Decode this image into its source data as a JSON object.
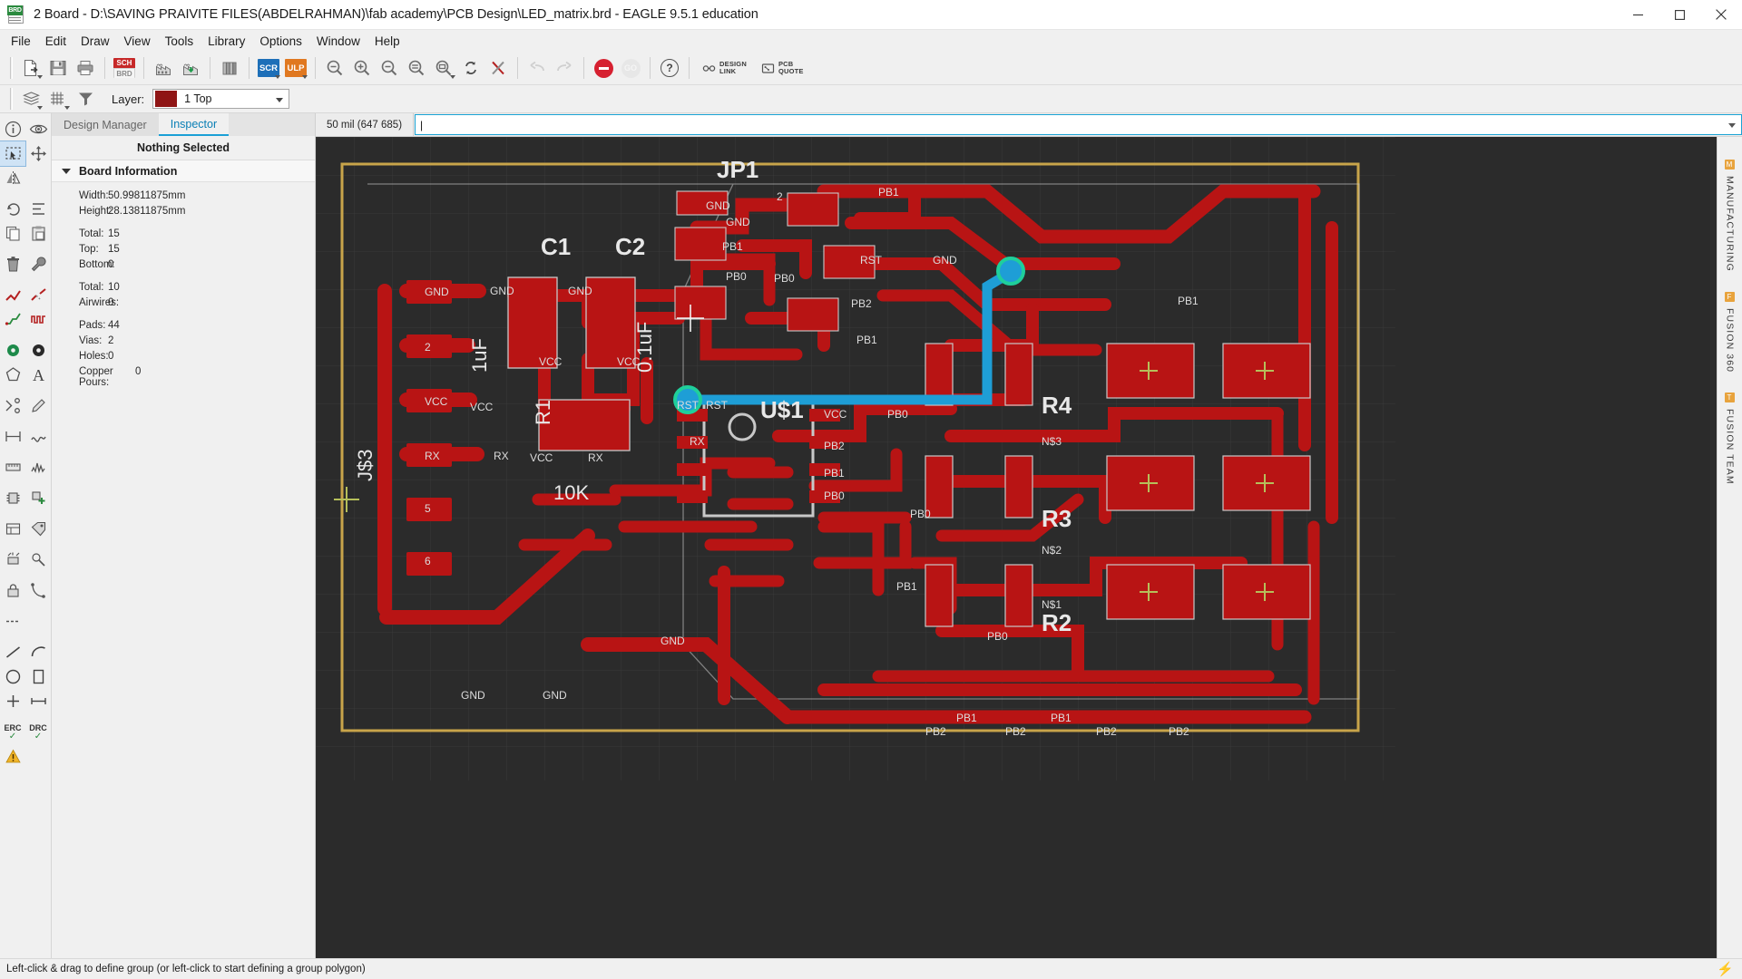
{
  "window": {
    "title": "2 Board - D:\\SAVING PRAIVITE FILES(ABDELRAHMAN)\\fab academy\\PCB Design\\LED_matrix.brd - EAGLE 9.5.1 education",
    "icon": "board-file-icon",
    "minimize_label": "Minimize",
    "maximize_label": "Maximize",
    "close_label": "Close"
  },
  "menu": {
    "items": [
      {
        "label": "File"
      },
      {
        "label": "Edit"
      },
      {
        "label": "Draw"
      },
      {
        "label": "View"
      },
      {
        "label": "Tools"
      },
      {
        "label": "Library"
      },
      {
        "label": "Options"
      },
      {
        "label": "Window"
      },
      {
        "label": "Help"
      }
    ]
  },
  "toolbar": {
    "buttons": [
      {
        "name": "open-file",
        "icon": "file-open-icon"
      },
      {
        "name": "save",
        "icon": "save-floppy-icon"
      },
      {
        "name": "print",
        "icon": "printer-icon"
      },
      {
        "name": "switch-to-schematic",
        "icon": "sch-brd-icon",
        "label_top": "SCH",
        "label_bottom": "BRD"
      },
      {
        "name": "cam-processor",
        "icon": "factory-icon"
      },
      {
        "name": "manufacturing-export",
        "icon": "factory-download-icon"
      },
      {
        "name": "library-manager",
        "icon": "books-icon"
      },
      {
        "name": "run-script",
        "icon": "scr-icon",
        "label": "SCR"
      },
      {
        "name": "run-ulp",
        "icon": "ulp-icon",
        "label": "ULP"
      },
      {
        "name": "zoom-fit",
        "icon": "zoom-fit-icon"
      },
      {
        "name": "zoom-in",
        "icon": "zoom-in-icon"
      },
      {
        "name": "zoom-out",
        "icon": "zoom-out-icon"
      },
      {
        "name": "zoom-redraw",
        "icon": "zoom-redraw-icon"
      },
      {
        "name": "zoom-select",
        "icon": "zoom-select-icon"
      },
      {
        "name": "refresh",
        "icon": "refresh-icon"
      },
      {
        "name": "ratsnest",
        "icon": "ratsnest-icon"
      },
      {
        "name": "undo",
        "icon": "undo-arrow-icon"
      },
      {
        "name": "redo",
        "icon": "redo-arrow-icon"
      },
      {
        "name": "stop",
        "icon": "stop-icon"
      },
      {
        "name": "go",
        "icon": "go-icon",
        "label": "GO"
      },
      {
        "name": "help",
        "icon": "question-mark-icon"
      }
    ],
    "design_link": {
      "line1": "DESIGN",
      "line2": "LINK",
      "icon": "design-link-icon"
    },
    "pcb_quote": {
      "line1": "PCB",
      "line2": "QUOTE",
      "icon": "pcb-quote-icon"
    }
  },
  "layerbar": {
    "layers_icon": "layers-stack-icon",
    "grid_icon": "grid-icon",
    "filter_icon": "funnel-filter-icon",
    "label": "Layer:",
    "selected": "1 Top",
    "swatch_color": "#8f1515"
  },
  "panel": {
    "tabs": [
      {
        "label": "Design Manager",
        "active": false
      },
      {
        "label": "Inspector",
        "active": true
      }
    ],
    "header": "Nothing Selected",
    "section_title": "Board Information",
    "rows": [
      {
        "key": "Width:",
        "value": "50.99811875mm"
      },
      {
        "key": "Height:",
        "value": "28.13811875mm"
      },
      {
        "gap": true
      },
      {
        "key": "Total:",
        "value": "15"
      },
      {
        "key": "Top:",
        "value": "15"
      },
      {
        "key": "Bottom:",
        "value": "0"
      },
      {
        "gap": true
      },
      {
        "key": "Total:",
        "value": "10"
      },
      {
        "key": "Airwires:",
        "value": "0"
      },
      {
        "gap": true
      },
      {
        "key": "Pads:",
        "value": "44"
      },
      {
        "key": "Vias:",
        "value": "2"
      },
      {
        "key": "Holes:",
        "value": "0"
      },
      {
        "key": "Copper Pours:",
        "value": "0"
      }
    ]
  },
  "command": {
    "grid_readout": "50 mil (647 685)",
    "input_value": "",
    "placeholder": ""
  },
  "rail": {
    "items": [
      {
        "name": "info",
        "icon": "info-circle-icon"
      },
      {
        "name": "show",
        "icon": "eye-icon"
      },
      {
        "name": "group",
        "icon": "group-select-icon",
        "selected": true
      },
      {
        "name": "move",
        "icon": "move-arrows-icon"
      },
      {
        "name": "mirror",
        "icon": "mirror-icon"
      },
      {
        "name": "rotate",
        "icon": "rotate-icon"
      },
      {
        "name": "change",
        "icon": "change-icon"
      },
      {
        "name": "copy",
        "icon": "copy-icon"
      },
      {
        "name": "paste",
        "icon": "paste-icon"
      },
      {
        "name": "delete",
        "icon": "trash-icon"
      },
      {
        "name": "optimize",
        "icon": "wrench-icon"
      },
      {
        "name": "route",
        "icon": "route-wire-icon"
      },
      {
        "name": "ripup",
        "icon": "ripup-icon"
      },
      {
        "name": "autorouter",
        "icon": "autorouter-icon"
      },
      {
        "name": "meander",
        "icon": "meander-icon"
      },
      {
        "name": "via",
        "icon": "via-icon"
      },
      {
        "name": "circle-pad",
        "icon": "filled-circle-icon"
      },
      {
        "name": "polygon",
        "icon": "polygon-icon"
      },
      {
        "name": "text",
        "icon": "text-a-icon"
      },
      {
        "name": "split",
        "icon": "split-icon"
      },
      {
        "name": "pencil",
        "icon": "pencil-icon"
      },
      {
        "name": "dimension",
        "icon": "dimension-icon"
      },
      {
        "name": "note",
        "icon": "note-icon"
      },
      {
        "name": "ruler",
        "icon": "ruler-icon"
      },
      {
        "name": "signal",
        "icon": "signal-wave-icon"
      },
      {
        "name": "package",
        "icon": "package-icon"
      },
      {
        "name": "add-part",
        "icon": "add-part-icon"
      },
      {
        "name": "replace",
        "icon": "replace-icon"
      },
      {
        "name": "attribute",
        "icon": "attribute-icon"
      },
      {
        "name": "name",
        "icon": "name-tag-icon"
      },
      {
        "name": "smash",
        "icon": "smash-icon"
      },
      {
        "name": "value",
        "icon": "value-icon"
      },
      {
        "name": "lock",
        "icon": "lock-icon"
      },
      {
        "name": "ratsnest",
        "icon": "ratsnest-tool-icon"
      },
      {
        "name": "airwire",
        "icon": "airwire-icon"
      },
      {
        "name": "line",
        "icon": "line-icon"
      },
      {
        "name": "arc",
        "icon": "arc-icon"
      },
      {
        "name": "circle",
        "icon": "circle-outline-icon"
      },
      {
        "name": "rect",
        "icon": "rectangle-icon"
      },
      {
        "name": "hole",
        "icon": "hole-plus-icon"
      },
      {
        "name": "mark",
        "icon": "mark-icon"
      },
      {
        "name": "erc",
        "icon": "erc-icon",
        "label": "ERC"
      },
      {
        "name": "drc",
        "icon": "drc-icon",
        "label": "DRC"
      },
      {
        "name": "warning",
        "icon": "warning-triangle-icon"
      }
    ],
    "resistor_label": "R2",
    "resistor_value": "10k"
  },
  "side_tabs": [
    {
      "label": "MANUFACTURING",
      "chip": "M"
    },
    {
      "label": "FUSION 360",
      "chip": "F"
    },
    {
      "label": "FUSION TEAM",
      "chip": "T"
    }
  ],
  "statusbar": {
    "message": "Left-click & drag to define group (or left-click to start defining a group polygon)",
    "indicator_icon": "lightning-bolt-icon"
  },
  "board": {
    "colors": {
      "background": "#2b2b2b",
      "top_copper": "#b81414",
      "board_outline": "#c8a44a",
      "tplace_silk": "#c8c8c8",
      "route_highlight": "#1e9ed6",
      "via_highlight": "#1fcf9b",
      "grid_line": "#3a3a3a",
      "origin_cross": "#b6bf5a"
    },
    "components": [
      {
        "name": "JP1",
        "label": "JP1"
      },
      {
        "name": "C1",
        "label": "C1",
        "value": "1uF"
      },
      {
        "name": "C2",
        "label": "C2",
        "value": "0.1uF"
      },
      {
        "name": "R1",
        "label": "R1",
        "value": "10k"
      },
      {
        "name": "R2",
        "label": "R2"
      },
      {
        "name": "R3",
        "label": "R3"
      },
      {
        "name": "R4",
        "label": "R4"
      },
      {
        "name": "U$1",
        "label": "U$1"
      },
      {
        "name": "J$3",
        "label": "J$3"
      }
    ],
    "net_labels": [
      "GND",
      "VCC",
      "RST",
      "RX",
      "PB0",
      "PB1",
      "PB2",
      "N$1",
      "N$2",
      "N$3"
    ]
  }
}
